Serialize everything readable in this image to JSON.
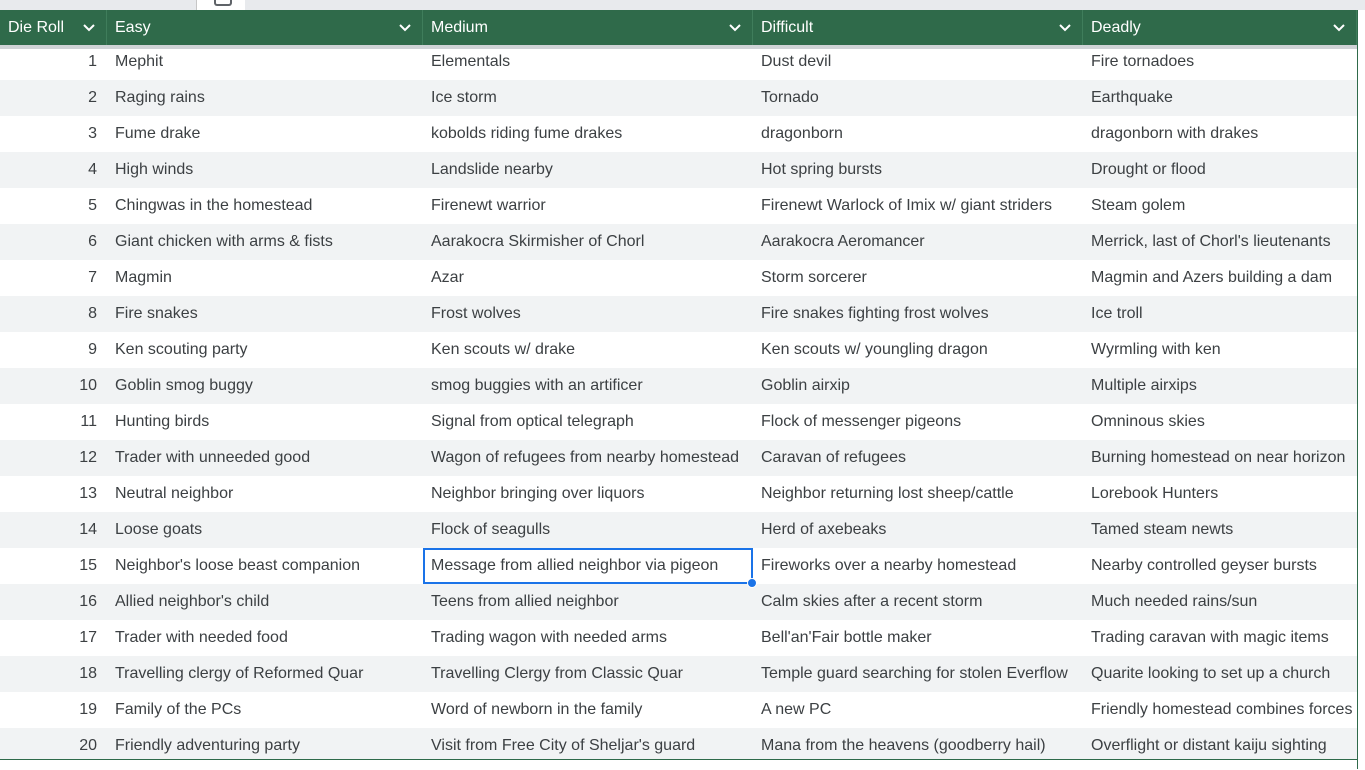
{
  "colors": {
    "header_bg": "#2f6a4a",
    "header_text": "#ffffff",
    "band_bg": "#f1f3f4",
    "selection": "#1a73e8"
  },
  "header": {
    "columns": [
      {
        "label": "Die Roll",
        "icon": "chevron-down-icon"
      },
      {
        "label": "Easy",
        "icon": "chevron-down-icon"
      },
      {
        "label": "Medium",
        "icon": "chevron-down-icon"
      },
      {
        "label": "Difficult",
        "icon": "chevron-down-icon"
      },
      {
        "label": "Deadly",
        "icon": "chevron-down-icon"
      }
    ]
  },
  "selected_cell": {
    "row": 15,
    "column": "Medium"
  },
  "rows": [
    [
      "1",
      "Mephit",
      "Elementals",
      "Dust devil",
      "Fire tornadoes"
    ],
    [
      "2",
      "Raging rains",
      "Ice storm",
      "Tornado",
      "Earthquake"
    ],
    [
      "3",
      "Fume drake",
      "kobolds riding fume drakes",
      "dragonborn",
      "dragonborn with drakes"
    ],
    [
      "4",
      "High winds",
      "Landslide nearby",
      "Hot spring bursts",
      "Drought or flood"
    ],
    [
      "5",
      "Chingwas in the homestead",
      "Firenewt warrior",
      "Firenewt Warlock of Imix w/  giant striders",
      "Steam golem"
    ],
    [
      "6",
      "Giant chicken with arms & fists",
      "Aarakocra Skirmisher of Chorl",
      "Aarakocra Aeromancer",
      "Merrick, last of Chorl's lieutenants"
    ],
    [
      "7",
      "Magmin",
      "Azar",
      "Storm sorcerer",
      "Magmin and Azers building a dam"
    ],
    [
      "8",
      "Fire snakes",
      "Frost wolves",
      "Fire snakes fighting frost wolves",
      "Ice troll"
    ],
    [
      "9",
      "Ken scouting party",
      "Ken scouts w/ drake",
      "Ken scouts w/ youngling dragon",
      "Wyrmling with ken"
    ],
    [
      "10",
      "Goblin smog buggy",
      "smog buggies with an artificer",
      "Goblin airxip",
      "Multiple airxips"
    ],
    [
      "11",
      "Hunting birds",
      "Signal from optical telegraph",
      "Flock of messenger pigeons",
      "Omninous skies"
    ],
    [
      "12",
      "Trader with unneeded good",
      "Wagon of refugees from nearby homestead",
      "Caravan of refugees",
      "Burning homestead on near horizon"
    ],
    [
      "13",
      "Neutral neighbor",
      "Neighbor bringing over liquors",
      "Neighbor returning lost sheep/cattle",
      "Lorebook Hunters"
    ],
    [
      "14",
      "Loose goats",
      "Flock of seagulls",
      "Herd of axebeaks",
      "Tamed steam newts"
    ],
    [
      "15",
      "Neighbor's loose beast companion",
      "Message from allied neighbor via pigeon",
      "Fireworks over a nearby homestead",
      "Nearby controlled geyser bursts"
    ],
    [
      "16",
      "Allied neighbor's child",
      "Teens from allied neighbor",
      "Calm skies after a recent storm",
      "Much needed rains/sun"
    ],
    [
      "17",
      "Trader with needed food",
      "Trading wagon with needed arms",
      "Bell'an'Fair bottle maker",
      "Trading caravan with magic items"
    ],
    [
      "18",
      "Travelling clergy of Reformed Quar",
      "Travelling Clergy from Classic Quar",
      "Temple guard searching for stolen Everflow",
      "Quarite looking to set up a church"
    ],
    [
      "19",
      "Family of the PCs",
      "Word of newborn in the family",
      "A new PC",
      "Friendly homestead combines forces"
    ],
    [
      "20",
      "Friendly adventuring party",
      "Visit from Free City of Sheljar's guard",
      "Mana from the heavens (goodberry hail)",
      "Overflight or distant kaiju sighting"
    ]
  ]
}
